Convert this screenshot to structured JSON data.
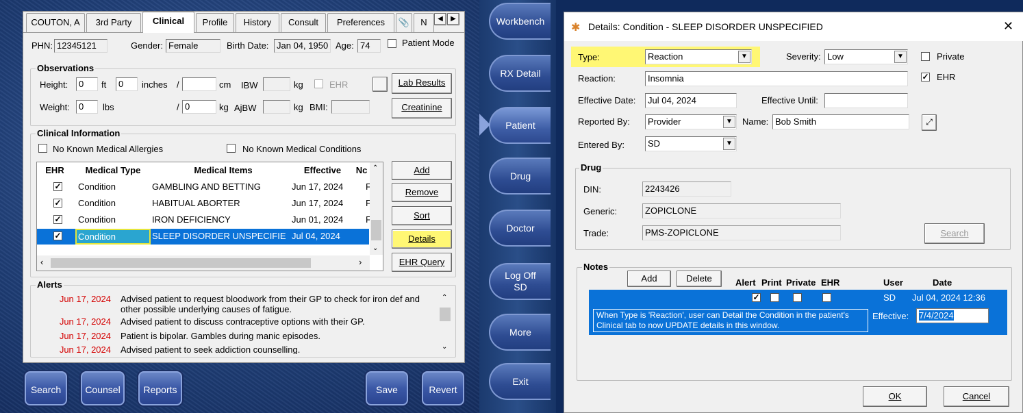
{
  "patient_tabs": [
    "COUTON, A",
    "3rd Party",
    "Clinical",
    "Profile",
    "History",
    "Consult",
    "Preferences"
  ],
  "patient": {
    "phn_label": "PHN:",
    "phn": "12345121",
    "gender_label": "Gender:",
    "gender": "Female",
    "birth_label": "Birth Date:",
    "birth": "Jan 04, 1950",
    "age_label": "Age:",
    "age": "74",
    "patient_mode": "Patient Mode"
  },
  "observations": {
    "title": "Observations",
    "height_label": "Height:",
    "height_ft": "0",
    "ft": "ft",
    "height_in": "0",
    "inches": "inches",
    "slash": "/",
    "cm": "cm",
    "ibw": "IBW",
    "kg": "kg",
    "ehr": "EHR",
    "weight_label": "Weight:",
    "weight_lbs": "0",
    "lbs": "lbs",
    "weight_kg": "0",
    "ajbw": "AjBW",
    "bmi": "BMI:",
    "lab_results": "Lab Results",
    "creatinine": "Creatinine"
  },
  "clinical": {
    "title": "Clinical Information",
    "nkma": "No Known Medical Allergies",
    "nkmc": "No Known Medical Conditions",
    "headers": [
      "EHR",
      "Medical Type",
      "Medical Items",
      "Effective",
      "Nc"
    ],
    "rows": [
      {
        "type": "Condition",
        "item": "GAMBLING AND BETTING",
        "date": "Jun 17, 2024",
        "n": "F"
      },
      {
        "type": "Condition",
        "item": "HABITUAL ABORTER",
        "date": "Jun 17, 2024",
        "n": "F"
      },
      {
        "type": "Condition",
        "item": "IRON DEFICIENCY",
        "date": "Jun 01, 2024",
        "n": "F"
      },
      {
        "type": "Condition",
        "item": "SLEEP DISORDER UNSPECIFIE",
        "date": "Jul 04, 2024",
        "n": ""
      }
    ],
    "buttons": {
      "add": "Add",
      "remove": "Remove",
      "sort": "Sort",
      "details": "Details",
      "ehr_query": "EHR Query"
    }
  },
  "alerts": {
    "title": "Alerts",
    "items": [
      {
        "date": "Jun 17, 2024",
        "text": "Advised patient to request bloodwork from their GP to check for iron def and other possible underlying causes of fatigue."
      },
      {
        "date": "Jun 17, 2024",
        "text": "Advised patient to discuss contraceptive options with their GP."
      },
      {
        "date": "Jun 17, 2024",
        "text": "Patient is bipolar. Gambles during manic episodes."
      },
      {
        "date": "Jun 17, 2024",
        "text": "Advised patient to seek addiction counselling."
      }
    ]
  },
  "bottom_buttons": {
    "search": "Search",
    "counsel": "Counsel",
    "reports": "Reports",
    "save": "Save",
    "revert": "Revert"
  },
  "rail": {
    "workbench": "Workbench",
    "rx_detail": "RX Detail",
    "patient": "Patient",
    "drug": "Drug",
    "doctor": "Doctor",
    "log_off": "Log Off",
    "log_off_user": "SD",
    "more": "More",
    "exit": "Exit"
  },
  "dialog": {
    "title": "Details: Condition - SLEEP DISORDER UNSPECIFIED",
    "close": "✕",
    "type_label": "Type:",
    "type": "Reaction",
    "severity_label": "Severity:",
    "severity": "Low",
    "private": "Private",
    "ehr": "EHR",
    "reaction_label": "Reaction:",
    "reaction": "Insomnia",
    "eff_date_label": "Effective Date:",
    "eff_date": "Jul 04, 2024",
    "eff_until_label": "Effective Until:",
    "eff_until": "",
    "reported_label": "Reported By:",
    "reported": "Provider",
    "name_label": "Name:",
    "name": "Bob Smith",
    "entered_label": "Entered By:",
    "entered": "SD",
    "drug_title": "Drug",
    "din_label": "DIN:",
    "din": "2243426",
    "generic_label": "Generic:",
    "generic": "ZOPICLONE",
    "trade_label": "Trade:",
    "trade": "PMS-ZOPICLONE",
    "search": "Search",
    "notes_title": "Notes",
    "notes_add": "Add",
    "notes_delete": "Delete",
    "notes_headers": {
      "alert": "Alert",
      "print": "Print",
      "private": "Private",
      "ehr": "EHR",
      "user": "User",
      "date": "Date"
    },
    "note": {
      "user": "SD",
      "date": "Jul 04, 2024 12:36",
      "text": "When Type is 'Reaction', user can Detail the Condition in the patient's Clinical tab to now UPDATE details in this window.",
      "effective_label": "Effective:",
      "effective": "7/4/2024"
    },
    "ok": "OK",
    "cancel": "Cancel"
  }
}
